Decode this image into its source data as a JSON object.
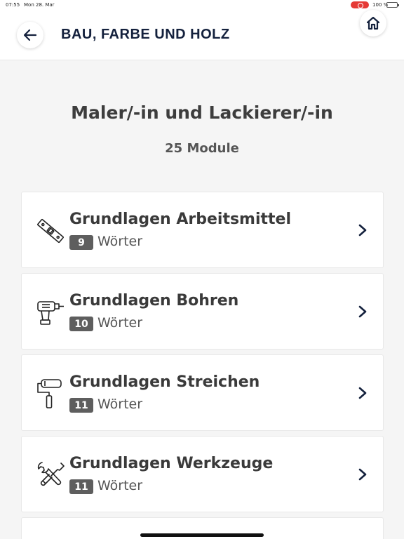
{
  "status_bar": {
    "time": "07:55",
    "date": "Mon 28. Mar",
    "battery": "100 %"
  },
  "header": {
    "title": "BAU, FARBE UND HOLZ"
  },
  "main": {
    "title": "Maler/-in und Lackierer/-in",
    "module_count": "25 Module"
  },
  "modules": [
    {
      "title": "Grundlagen Arbeitsmittel",
      "count": "9",
      "unit": "Wörter",
      "icon": "spirit-level-icon"
    },
    {
      "title": "Grundlagen Bohren",
      "count": "10",
      "unit": "Wörter",
      "icon": "drill-icon"
    },
    {
      "title": "Grundlagen Streichen",
      "count": "11",
      "unit": "Wörter",
      "icon": "paint-roller-icon"
    },
    {
      "title": "Grundlagen Werkzeuge",
      "count": "11",
      "unit": "Wörter",
      "icon": "tools-icon"
    }
  ],
  "colors": {
    "header_title": "#14213d",
    "badge": "#5e5e5e",
    "background": "#f5f5f5"
  }
}
